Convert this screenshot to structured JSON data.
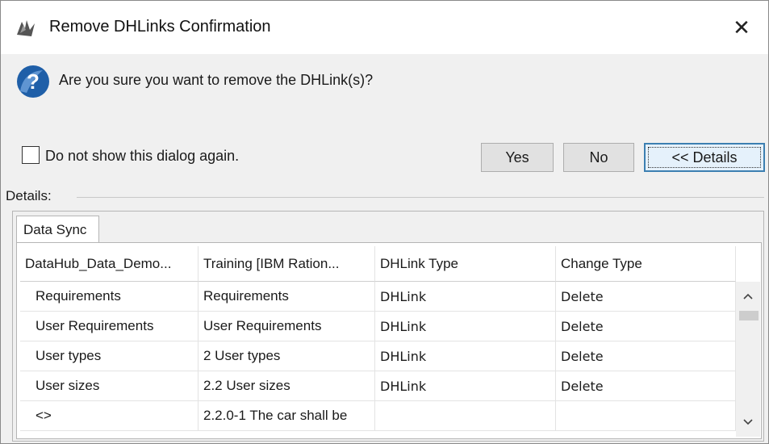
{
  "window": {
    "title": "Remove DHLinks Confirmation",
    "close_label": "✕"
  },
  "message": {
    "text": "Are you sure you want to remove the DHLink(s)?"
  },
  "options": {
    "dont_show_label": "Do not show this dialog again.",
    "dont_show_checked": false
  },
  "buttons": {
    "yes_label": "Yes",
    "no_label": "No",
    "details_label": "<< Details"
  },
  "details": {
    "section_label": "Details:",
    "tab_label": "Data Sync",
    "columns": [
      "DataHub_Data_Demo...",
      "Training [IBM Ration...",
      "DHLink Type",
      "Change Type"
    ],
    "rows": [
      [
        "Requirements",
        "Requirements",
        "DHLink",
        "Delete"
      ],
      [
        "User Requirements",
        "User Requirements",
        "DHLink",
        "Delete"
      ],
      [
        "User types",
        "2 User types",
        "DHLink",
        "Delete"
      ],
      [
        "User sizes",
        "2.2 User sizes",
        "DHLink",
        "Delete"
      ],
      [
        "<>",
        "2.2.0-1 The car shall be",
        "",
        ""
      ]
    ]
  },
  "icons": {
    "app": "app-icon",
    "question": "question-icon",
    "scroll_up": "chevron-up-icon",
    "scroll_down": "chevron-down-icon"
  },
  "colors": {
    "dialog_bg": "#f0f0f0",
    "accent_border": "#3c7fb1",
    "question_blue": "#1f5fa8"
  }
}
